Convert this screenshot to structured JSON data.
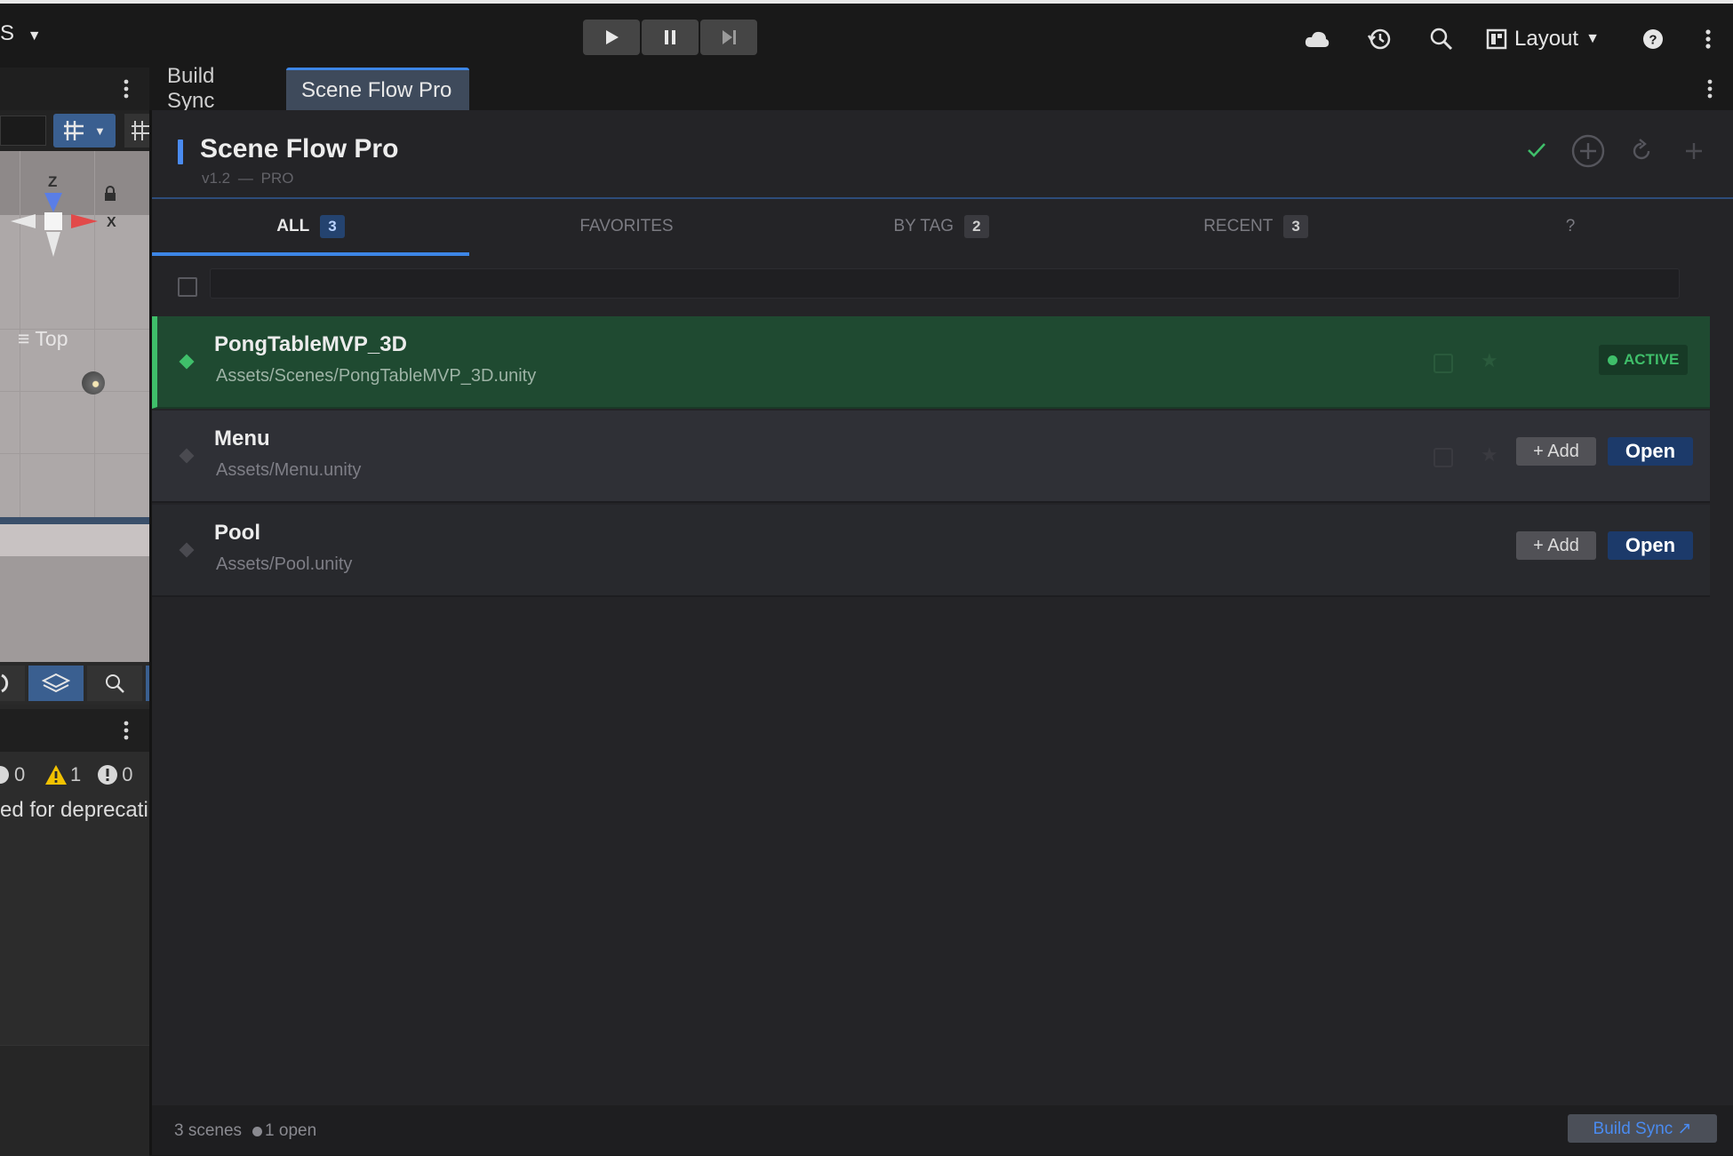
{
  "toolbar": {
    "account_label": "S",
    "layout_label": "Layout",
    "icons": [
      "play-icon",
      "pause-icon",
      "step-icon",
      "cloud-icon",
      "history-icon",
      "search-icon",
      "layout-icon",
      "help-icon",
      "more-icon"
    ]
  },
  "left_panel": {
    "axis_z": "Z",
    "axis_x": "X",
    "view_label": "Top",
    "console_counts": {
      "info": "0",
      "warnings": "1",
      "errors": "0"
    },
    "console_message": "ed for deprecati"
  },
  "tabs": [
    {
      "label": "Build Sync",
      "active": false
    },
    {
      "label": "Scene Flow Pro",
      "active": true
    }
  ],
  "panel": {
    "title": "Scene Flow Pro",
    "version": "v1.2",
    "edition": "PRO",
    "filters": [
      {
        "label": "ALL",
        "count": "3",
        "active": true
      },
      {
        "label": "FAVORITES",
        "count": "",
        "active": false
      },
      {
        "label": "BY TAG",
        "count": "2",
        "active": false
      },
      {
        "label": "RECENT",
        "count": "3",
        "active": false
      },
      {
        "label": "?",
        "count": "",
        "active": false
      }
    ],
    "scenes": [
      {
        "name": "PongTableMVP_3D",
        "path": "Assets/Scenes/PongTableMVP_3D.unity",
        "active": true,
        "status": "ACTIVE"
      },
      {
        "name": "Menu",
        "path": "Assets/Menu.unity",
        "active": false,
        "add_label": "+ Add",
        "open_label": "Open"
      },
      {
        "name": "Pool",
        "path": "Assets/Pool.unity",
        "active": false,
        "add_label": "+ Add",
        "open_label": "Open"
      }
    ],
    "footer": {
      "scene_count": "3 scenes",
      "open_count": "1 open",
      "build_sync_label": "Build Sync ↗"
    }
  },
  "colors": {
    "accent": "#3d86e6",
    "active_row": "#1f4a31",
    "active_green": "#3fbf6a",
    "open_button": "#1c3a6a"
  }
}
